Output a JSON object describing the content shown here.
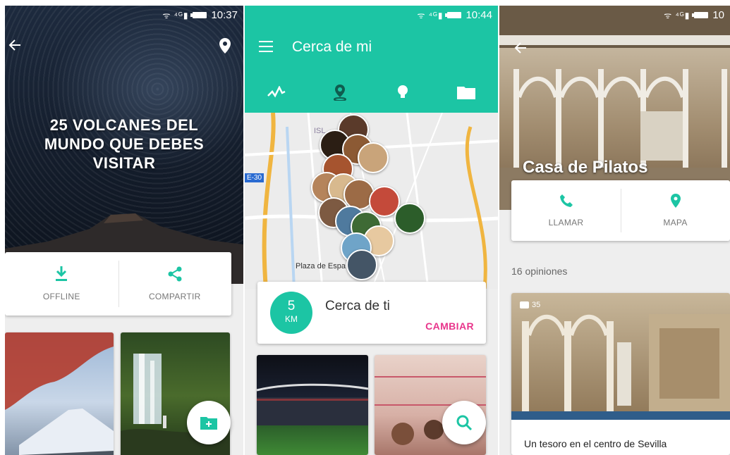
{
  "screens": {
    "volcanoes": {
      "status_time": "10:37",
      "title": "25 VOLCANES DEL MUNDO QUE DEBES VISITAR",
      "back_icon": "arrow-left-icon",
      "location_icon": "map-pin-icon",
      "actions": [
        {
          "label": "OFFLINE",
          "icon": "download-icon"
        },
        {
          "label": "COMPARTIR",
          "icon": "share-icon"
        }
      ],
      "fab_icon": "add-folder-icon",
      "accent": "#1cc5a4"
    },
    "nearby": {
      "status_time": "10:44",
      "title": "Cerca de mi",
      "tabs": [
        {
          "name": "activity",
          "icon": "activity-icon"
        },
        {
          "name": "location",
          "icon": "location-pin-icon"
        },
        {
          "name": "tips",
          "icon": "lightbulb-icon"
        },
        {
          "name": "folders",
          "icon": "folder-icon"
        }
      ],
      "map": {
        "road_label": "E-30",
        "place_label": "Plaza de Espa",
        "isl_label": "ISL"
      },
      "distance": {
        "value": "5",
        "unit": "KM"
      },
      "near_title": "Cerca de ti",
      "change_button": "CAMBIAR",
      "fab_icon": "search-icon",
      "accent": "#1cc5a4",
      "link_color": "#e8358b"
    },
    "place": {
      "status_time": "10",
      "name": "Casa de Pilatos",
      "actions": [
        {
          "label": "LLAMAR",
          "icon": "phone-icon"
        },
        {
          "label": "MAPA",
          "icon": "map-pin-icon"
        }
      ],
      "reviews_count": "16 opiniones",
      "review": {
        "photos": "35",
        "caption": "Un tesoro en el centro de Sevilla"
      }
    }
  }
}
